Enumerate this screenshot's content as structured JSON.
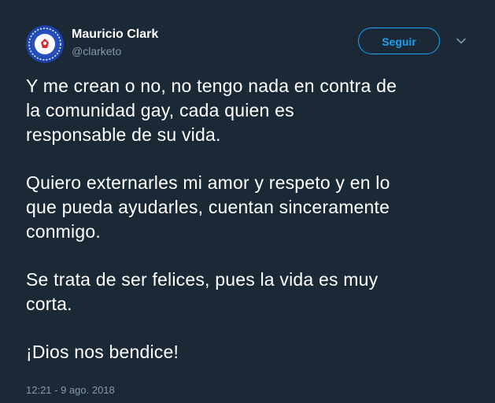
{
  "author": {
    "name": "Mauricio Clark",
    "handle": "@clarketo",
    "avatar_icon": "profile-avatar"
  },
  "follow_button": {
    "label": "Seguir"
  },
  "menu_icon": "chevron-down-icon",
  "tweet": {
    "paragraphs": [
      {
        "lines": [
          "Y me crean o no, no tengo nada en contra de",
          "la comunidad gay, cada quien es",
          "responsable de su vida."
        ]
      },
      {
        "lines": [
          "Quiero externarles mi amor y respeto y en lo",
          "que pueda ayudarles, cuentan sinceramente",
          "conmigo."
        ]
      },
      {
        "lines": [
          "Se trata de ser felices, pues la vida es muy",
          "corta."
        ]
      },
      {
        "lines": [
          "¡Dios nos bendice!"
        ]
      }
    ],
    "timestamp": "12:21 - 9 ago. 2018"
  },
  "colors": {
    "background": "#1b2836",
    "accent": "#1da1f2",
    "secondary_text": "#8899a6",
    "primary_text": "#ffffff"
  }
}
